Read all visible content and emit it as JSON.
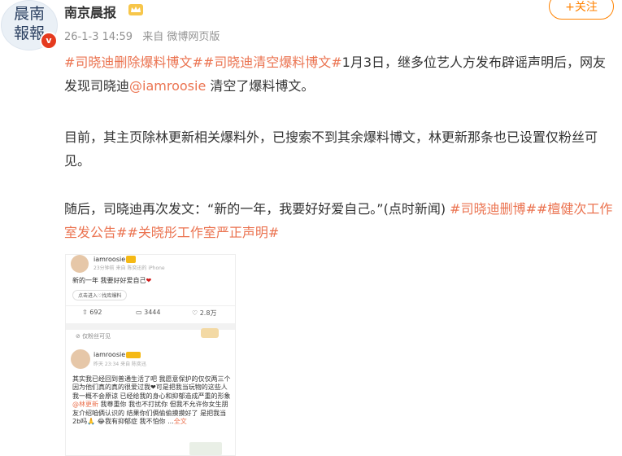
{
  "account": {
    "avatar_logo": "晨南\n報報",
    "name": "南京晨报",
    "timestamp": "26-1-3 14:59",
    "source": "来自 微博网页版",
    "follow_label": "+关注"
  },
  "post": {
    "p1_tag1": "#司晓迪删除爆料博文#",
    "p1_tag2": "#司晓迪清空爆料博文#",
    "p1_text1": "1月3日，继多位艺人方发布辟谣声明后，网友发现司晓迪",
    "p1_mention": "@iamroosie",
    "p1_text2": " 清空了爆料博文。",
    "p2": "目前，其主页除林更新相关爆料外，已搜索不到其余爆料博文，林更新那条也已设置仅粉丝可见。",
    "p3_text": "随后，司晓迪再次发文：“新的一年，我要好好爱自己。”(点时新闻) ",
    "p3_tag1": "#司晓迪删博#",
    "p3_tag2": "#檀健次工作室发公告#",
    "p3_tag3": "#关晓彤工作室严正声明#"
  },
  "embedded": {
    "name": "iamroosie",
    "meta1": "23分钟前 来自 陈奕迅的 iPhone",
    "post": "新的一年 我要好好爱自己",
    "chip": "点击进入♡找库爆料",
    "stat_repost": "692",
    "stat_comment": "3444",
    "stat_like": "2.8万",
    "only_fans": "仅粉丝可见",
    "name2": "iamroosie",
    "meta2": "昨天 23:34 来自 陈奕迅",
    "body": "其实我已经回到普通生活了吧 我愿意保护的仅仅两三个 因为他们真的真的很爱过我❤可是把我当玩物的这些人 我一概不会原谅 已经给我的身心和抑郁造成严重的形象",
    "body_mention": "@林更新",
    "body2": " 我尊重你 我也不打扰你 但我不允许你女生朋友介绍咱俩认识的 结果你们俩偷偷摸摸好了 是把我当2b吗🙏 😂我有抑郁症 我不怕你 ...",
    "body_more": "全文"
  },
  "colors": {
    "accent": "#ff8200",
    "tag": "#eb7350",
    "meta": "#939393",
    "text": "#333333"
  }
}
